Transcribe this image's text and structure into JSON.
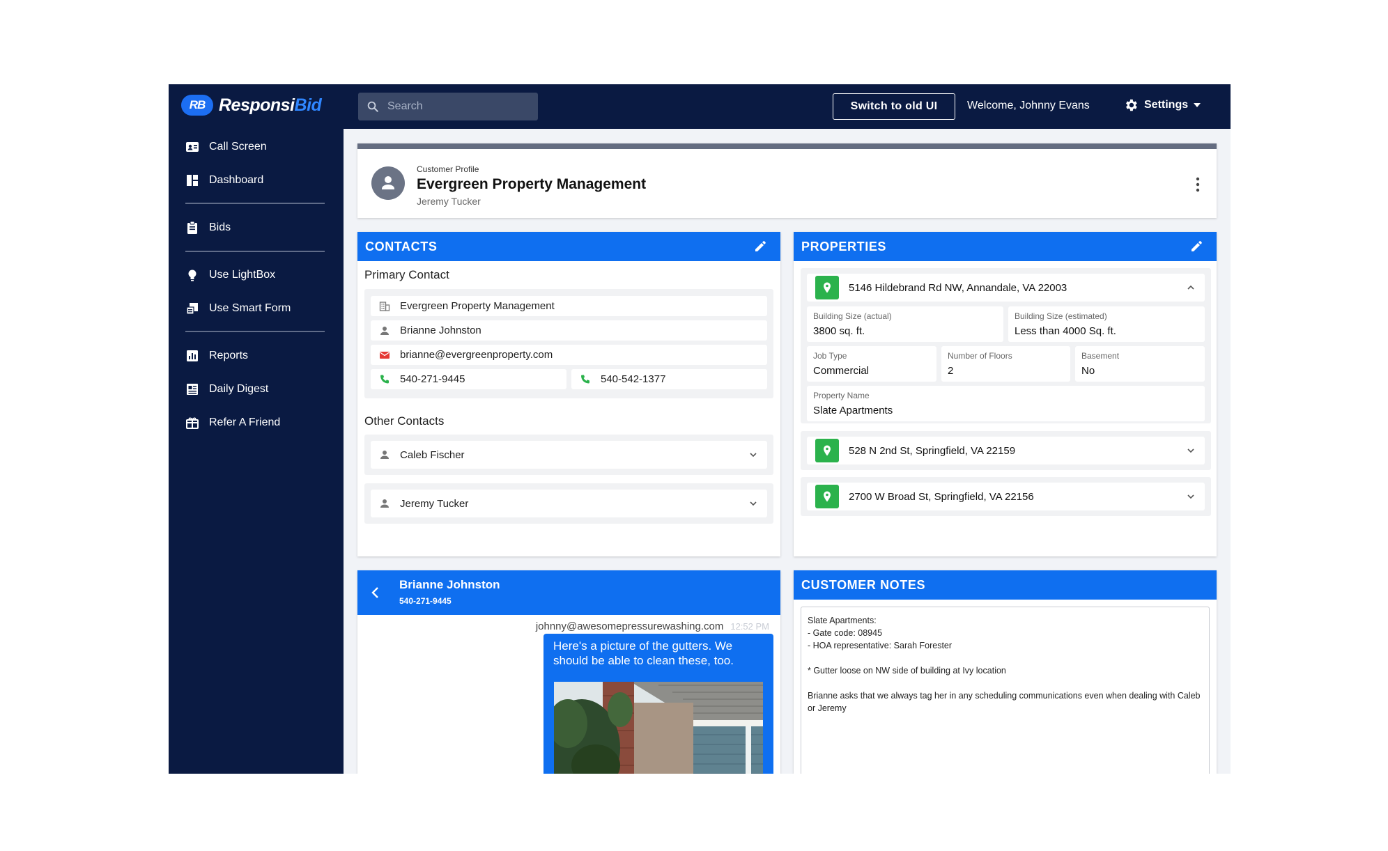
{
  "brand": {
    "badge": "RB",
    "name_main": "Responsi",
    "name_accent": "Bid",
    "accent_color": "#2f86ff"
  },
  "search": {
    "placeholder": "Search"
  },
  "header": {
    "switch_label": "Switch to old UI",
    "welcome": "Welcome, Johnny Evans",
    "settings_label": "Settings"
  },
  "sidebar": {
    "items": [
      {
        "label": "Call Screen",
        "icon": "contact-card-icon"
      },
      {
        "label": "Dashboard",
        "icon": "dashboard-icon"
      },
      {
        "label": "Bids",
        "icon": "clipboard-icon"
      },
      {
        "label": "Use LightBox",
        "icon": "lightbulb-icon"
      },
      {
        "label": "Use Smart Form",
        "icon": "form-icon"
      },
      {
        "label": "Reports",
        "icon": "bar-chart-icon"
      },
      {
        "label": "Daily Digest",
        "icon": "newspaper-icon"
      },
      {
        "label": "Refer A Friend",
        "icon": "gift-icon"
      }
    ]
  },
  "profile": {
    "label": "Customer Profile",
    "name": "Evergreen Property Management",
    "contact": "Jeremy Tucker"
  },
  "contacts": {
    "title": "CONTACTS",
    "primary_title": "Primary Contact",
    "primary": {
      "company": "Evergreen Property Management",
      "name": "Brianne Johnston",
      "email": "brianne@evergreenproperty.com",
      "phone1": "540-271-9445",
      "phone2": "540-542-1377"
    },
    "other_title": "Other Contacts",
    "others": [
      "Caleb Fischer",
      "Jeremy Tucker"
    ]
  },
  "properties": {
    "title": "PROPERTIES",
    "expanded": {
      "address": "5146 Hildebrand Rd NW, Annandale, VA 22003",
      "building_size_actual_label": "Building Size (actual)",
      "building_size_actual": "3800 sq. ft.",
      "building_size_est_label": "Building Size (estimated)",
      "building_size_est": "Less than 4000 Sq. ft.",
      "job_type_label": "Job Type",
      "job_type": "Commercial",
      "floors_label": "Number of Floors",
      "floors": "2",
      "basement_label": "Basement",
      "basement": "No",
      "property_name_label": "Property Name",
      "property_name": "Slate Apartments"
    },
    "collapsed": [
      "528 N 2nd St, Springfield, VA 22159",
      "2700 W Broad St, Springfield, VA 22156"
    ]
  },
  "conversation": {
    "name": "Brianne Johnston",
    "phone": "540-271-9445",
    "sender": "johnny@awesomepressurewashing.com",
    "time": "12:52 PM",
    "text": "Here's a picture of the gutters. We should be able to clean these, too."
  },
  "notes": {
    "title": "CUSTOMER NOTES",
    "body": "Slate Apartments:\n- Gate code: 08945\n- HOA representative: Sarah Forester\n\n* Gutter loose on NW side of building at Ivy location\n\nBrianne asks that we always tag her in any scheduling communications even when dealing with Caleb or Jeremy"
  },
  "colors": {
    "navy": "#0a1a42",
    "primary_blue": "#0f6ff0",
    "pin_green": "#2bb24c",
    "email_red": "#e53935"
  }
}
